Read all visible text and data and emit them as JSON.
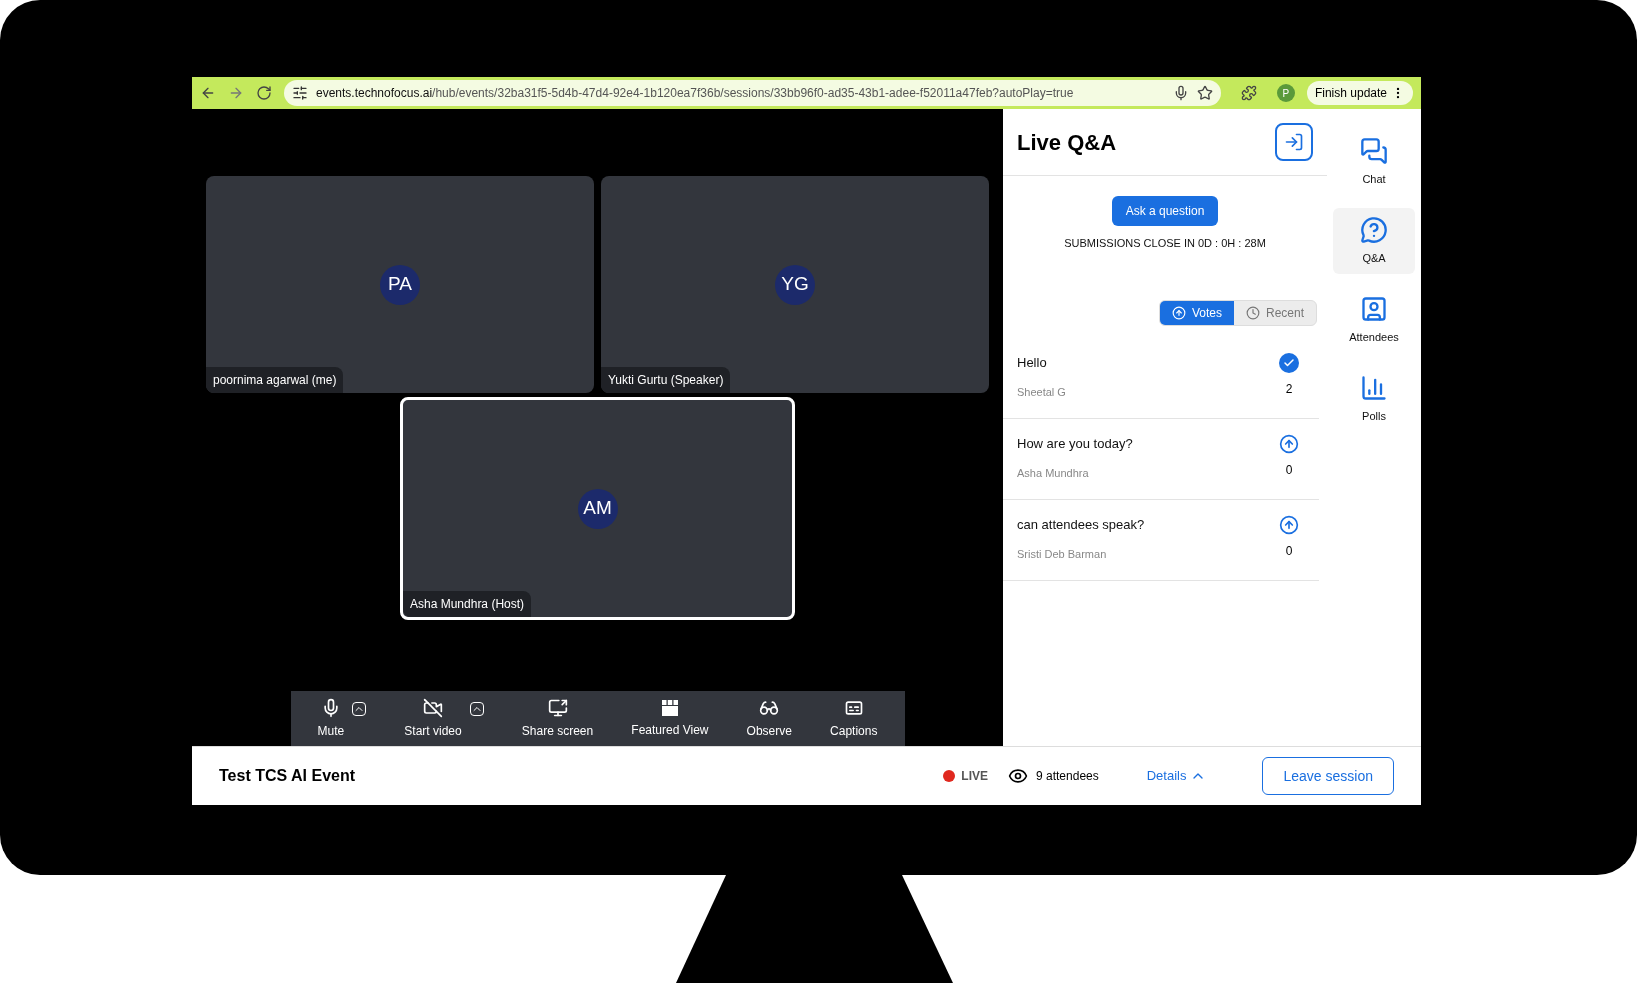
{
  "browser": {
    "url_host": "events.technofocus.ai",
    "url_path": "/hub/events/32ba31f5-5d4b-47d4-92e4-1b120ea7f36b/sessions/33bb96f0-ad35-43b1-adee-f52011a47feb?autoPlay=true",
    "profile": "P",
    "update_button": "Finish update"
  },
  "tiles": [
    {
      "initials": "PA",
      "name": "poornima agarwal (me)",
      "selected": false
    },
    {
      "initials": "YG",
      "name": "Yukti Gurtu (Speaker)",
      "selected": false
    },
    {
      "initials": "AM",
      "name": "Asha Mundhra (Host)",
      "selected": true
    }
  ],
  "controls": [
    {
      "kind": "mic",
      "label": "Mute",
      "menu": true
    },
    {
      "kind": "video",
      "label": "Start video",
      "menu": true
    },
    {
      "kind": "share",
      "label": "Share screen",
      "menu": false
    },
    {
      "kind": "featured",
      "label": "Featured View",
      "menu": false
    },
    {
      "kind": "observe",
      "label": "Observe",
      "menu": false
    },
    {
      "kind": "captions",
      "label": "Captions",
      "menu": false
    }
  ],
  "qa": {
    "title": "Live Q&A",
    "ask_button": "Ask a question",
    "deadline": "SUBMISSIONS CLOSE IN 0D : 0H : 28M",
    "sort_tabs": [
      {
        "kind": "votes",
        "label": "Votes",
        "selected": true
      },
      {
        "kind": "recent",
        "label": "Recent",
        "selected": false
      }
    ],
    "questions": [
      {
        "text": "Hello",
        "author": "Sheetal G",
        "votes": "2",
        "voted": true
      },
      {
        "text": "How are you today?",
        "author": "Asha Mundhra",
        "votes": "0",
        "voted": false
      },
      {
        "text": "can attendees speak?",
        "author": "Sristi Deb Barman",
        "votes": "0",
        "voted": false
      }
    ]
  },
  "rail": [
    {
      "kind": "chat",
      "label": "Chat",
      "selected": false
    },
    {
      "kind": "qa",
      "label": "Q&A",
      "selected": true
    },
    {
      "kind": "attendees",
      "label": "Attendees",
      "selected": false
    },
    {
      "kind": "polls",
      "label": "Polls",
      "selected": false
    }
  ],
  "status_bar": {
    "event_title": "Test TCS AI Event",
    "live": "LIVE",
    "attendees": "9 attendees",
    "details": "Details",
    "leave_button": "Leave session"
  }
}
